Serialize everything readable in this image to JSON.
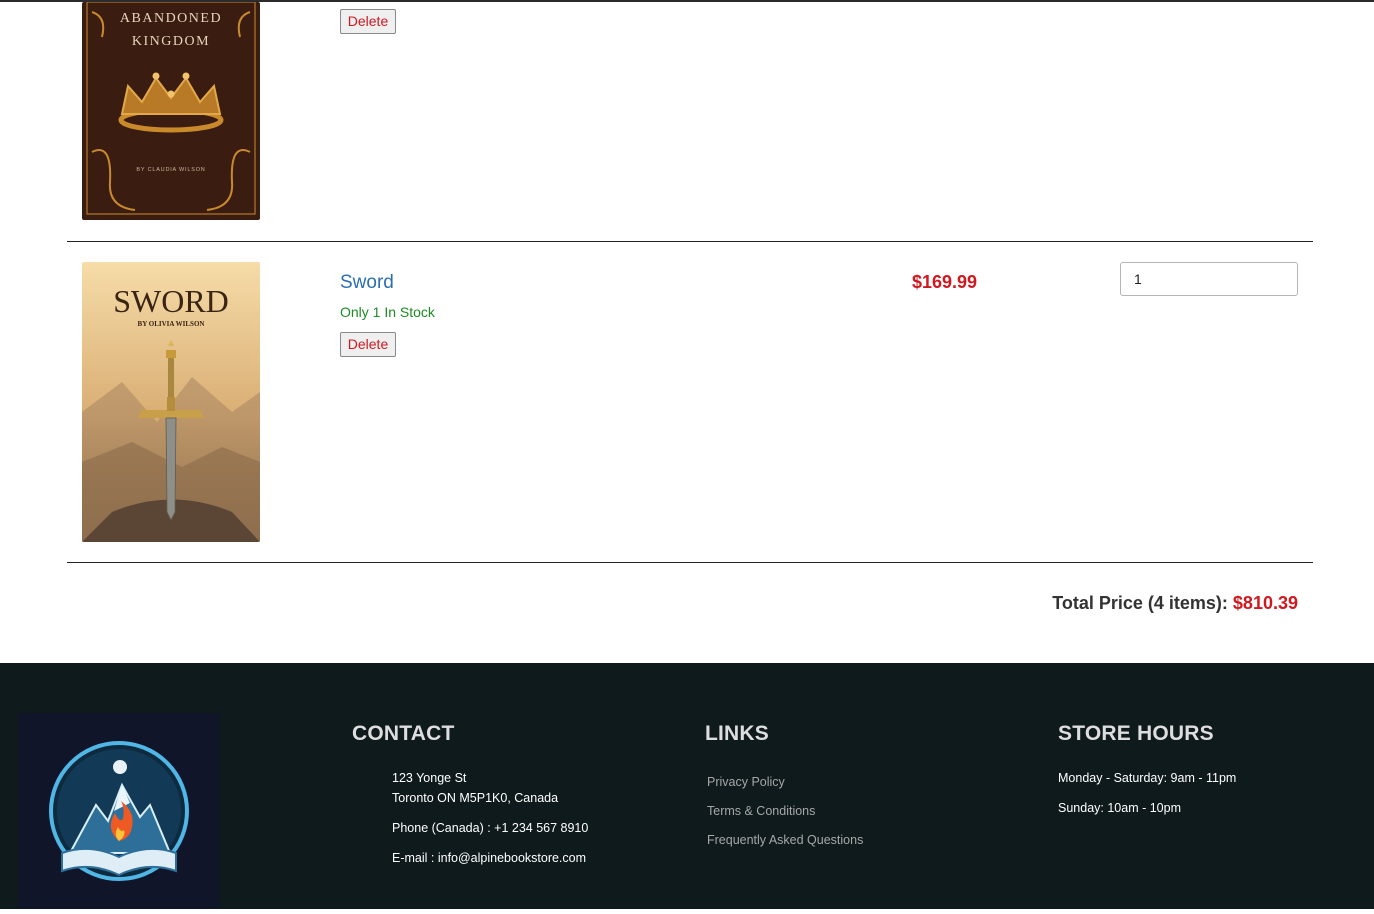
{
  "cart": {
    "items": [
      {
        "cover_title_line1": "ABANDONED",
        "cover_title_line2": "KINGDOM",
        "cover_author": "BY CLAUDIA WILSON",
        "delete_label": "Delete"
      },
      {
        "title": "Sword",
        "stock": "Only 1 In Stock",
        "price": "$169.99",
        "quantity": "1",
        "delete_label": "Delete",
        "cover_title": "SWORD",
        "cover_author": "BY OLIVIA WILSON"
      }
    ],
    "total_label": "Total Price (4 items):",
    "total_amount": "$810.39"
  },
  "footer": {
    "contact": {
      "heading": "CONTACT",
      "address_line1": "123 Yonge St",
      "address_line2": "Toronto ON M5P1K0, Canada",
      "phone": "Phone (Canada) : +1 234 567 8910",
      "email": "E-mail : info@alpinebookstore.com"
    },
    "links": {
      "heading": "LINKS",
      "items": [
        "Privacy Policy",
        "Terms & Conditions",
        "Frequently Asked Questions"
      ]
    },
    "hours": {
      "heading": "STORE HOURS",
      "weekdays": "Monday - Saturday: 9am - 11pm",
      "sunday": "Sunday: 10am - 10pm"
    }
  },
  "colors": {
    "price_red": "#d0191f",
    "link_blue": "#2a6fb0",
    "stock_green": "#1e8a24",
    "footer_bg": "#0f1a1c"
  }
}
